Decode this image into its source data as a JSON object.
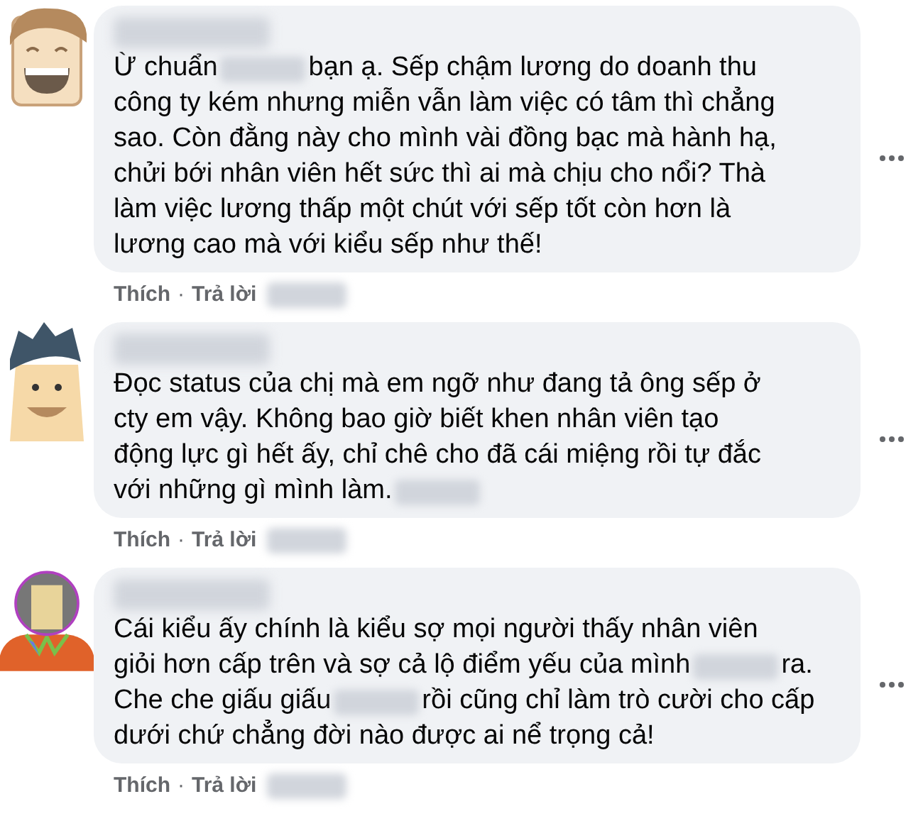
{
  "comments": [
    {
      "kind": "laughing",
      "lines": [
        [
          {
            "kind": "text",
            "text": "Ừ chuẩn"
          },
          {
            "kind": "blur"
          },
          {
            "kind": "text",
            "text": "bạn ạ. Sếp chậm lương do doanh thu"
          }
        ],
        [
          {
            "kind": "text",
            "text": "công ty kém nhưng miễn vẫn làm việc có tâm thì chẳng"
          }
        ],
        [
          {
            "kind": "text",
            "text": "sao. Còn đằng này cho mình vài đồng bạc mà hành hạ,"
          }
        ],
        [
          {
            "kind": "text",
            "text": "chửi bới nhân viên hết sức thì ai mà chịu cho nổi? Thà"
          }
        ],
        [
          {
            "kind": "text",
            "text": "làm việc lương thấp một chút với sếp tốt còn hơn là"
          }
        ],
        [
          {
            "kind": "text",
            "text": "lương cao mà với kiểu sếp như thế!"
          }
        ]
      ],
      "actions": [
        {
          "label": "Thích"
        },
        {
          "label": "Trả lời"
        }
      ],
      "separator": "·"
    },
    {
      "kind": "man",
      "lines": [
        [
          {
            "kind": "text",
            "text": "Đọc status của chị mà em ngỡ như đang tả ông sếp ở"
          }
        ],
        [
          {
            "kind": "text",
            "text": "cty em vậy. Không bao giờ biết khen nhân viên tạo"
          }
        ],
        [
          {
            "kind": "text",
            "text": "động lực gì hết ấy, chỉ chê cho đã cái miệng rồi tự đắc"
          }
        ],
        [
          {
            "kind": "text",
            "text": "với những gì mình làm."
          },
          {
            "kind": "blur"
          }
        ]
      ],
      "actions": [
        {
          "label": "Thích"
        },
        {
          "label": "Trả lời"
        }
      ],
      "separator": "·"
    },
    {
      "kind": "woman",
      "lines": [
        [
          {
            "kind": "text",
            "text": "Cái kiểu ấy chính là kiểu sợ mọi người thấy nhân viên"
          }
        ],
        [
          {
            "kind": "text",
            "text": "giỏi hơn cấp trên và sợ cả lộ điểm yếu của mình"
          },
          {
            "kind": "blur"
          },
          {
            "kind": "text",
            "text": "ra."
          }
        ],
        [
          {
            "kind": "text",
            "text": "Che che giấu giấu"
          },
          {
            "kind": "blur"
          },
          {
            "kind": "text",
            "text": "rồi cũng chỉ làm trò cười cho cấp"
          }
        ],
        [
          {
            "kind": "text",
            "text": "dưới chứ chẳng đời nào được ai nể trọng cả!"
          }
        ]
      ],
      "actions": [
        {
          "label": "Thích"
        },
        {
          "label": "Trả lời"
        }
      ],
      "separator": "·"
    }
  ]
}
